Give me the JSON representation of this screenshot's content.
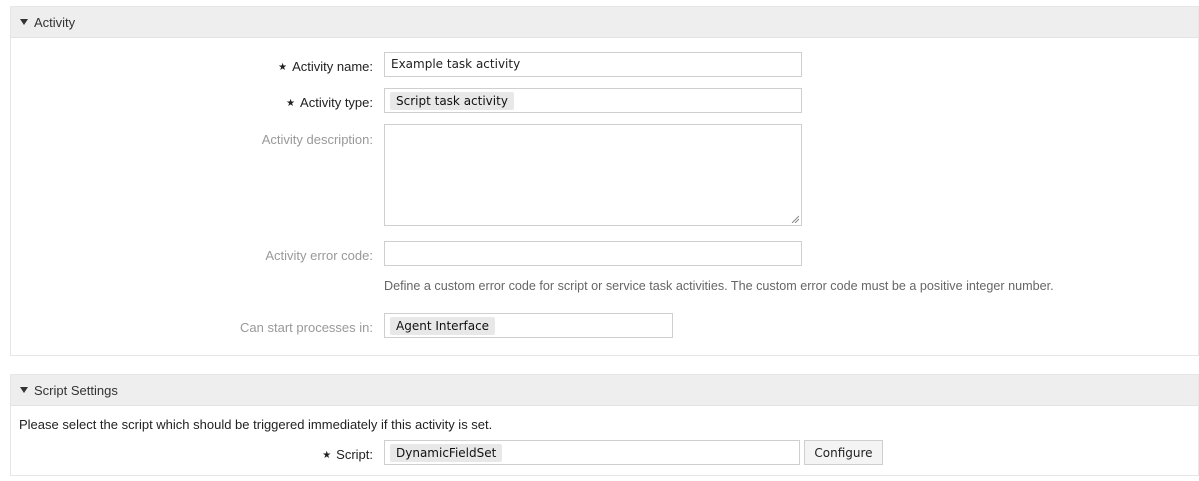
{
  "activity_section": {
    "title": "Activity",
    "fields": {
      "name": {
        "label": "Activity name:",
        "value": "Example task activity"
      },
      "type": {
        "label": "Activity type:",
        "value": "Script task activity"
      },
      "description": {
        "label": "Activity description:",
        "value": ""
      },
      "error_code": {
        "label": "Activity error code:",
        "value": "",
        "hint": "Define a custom error code for script or service task activities. The custom error code must be a positive integer number."
      },
      "start_processes": {
        "label": "Can start processes in:",
        "value": "Agent Interface"
      }
    }
  },
  "script_section": {
    "title": "Script Settings",
    "instruction": "Please select the script which should be triggered immediately if this activity is set.",
    "script": {
      "label": "Script:",
      "value": "DynamicFieldSet",
      "configure_label": "Configure"
    }
  },
  "required_marker": "★"
}
